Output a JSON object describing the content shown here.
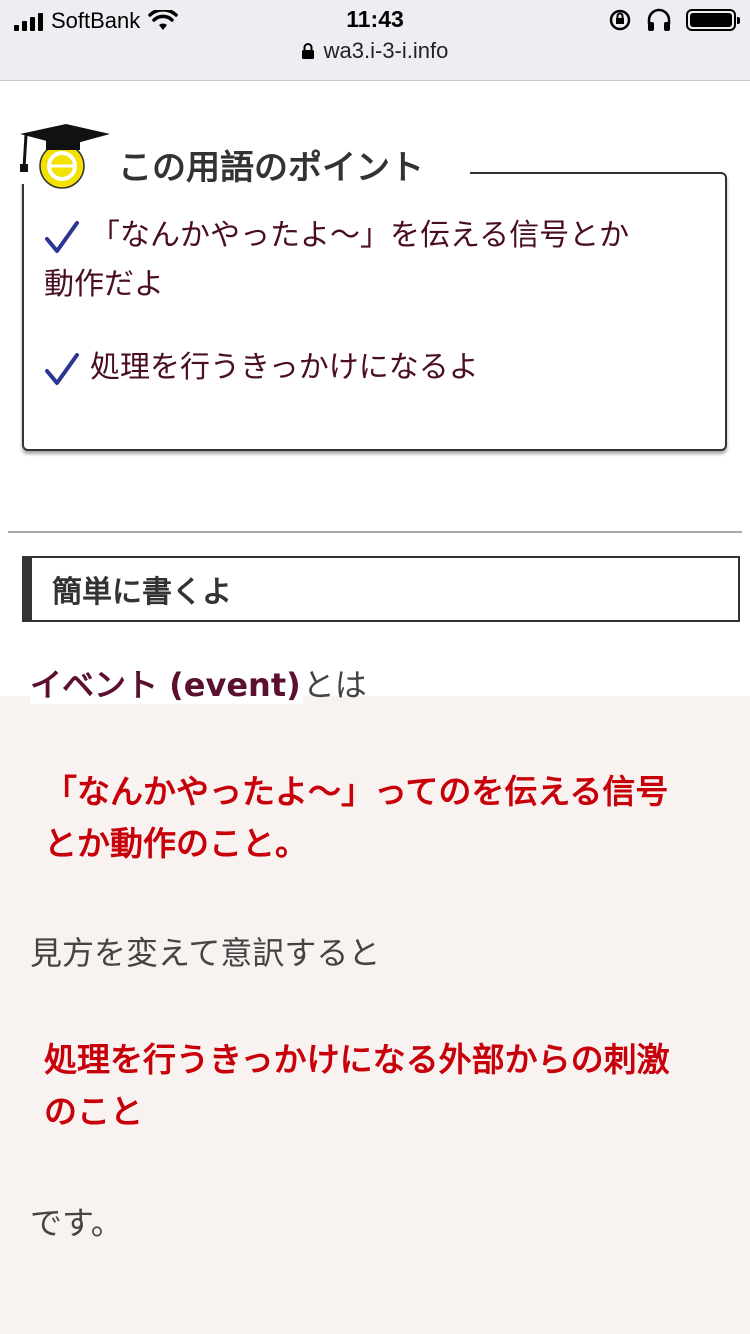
{
  "status": {
    "carrier": "SoftBank",
    "time": "11:43",
    "url": "wa3.i-3-i.info"
  },
  "point": {
    "title": "この用語のポイント",
    "items": [
      "「なんかやった",
      "よ〜」を伝える信号とか",
      "動作だよ",
      "処理を行うきっかけになるよ"
    ]
  },
  "section": {
    "heading": "簡単に書くよ"
  },
  "definition": {
    "term": "イベント (event)",
    "term_suffix": "とは",
    "red_1_line1": "「なんかやったよ〜」ってのを伝える信号",
    "red_1_line2": "とか動作のこと。",
    "middle": "見方を変えて意訳すると",
    "red_2_line1": "処理を行うきっかけになる外部からの刺激",
    "red_2_line2": "のこと",
    "ending": "です。"
  },
  "colors": {
    "accent_red": "#c8000a",
    "term_color": "#5c1031",
    "check_color": "#2c3591"
  }
}
